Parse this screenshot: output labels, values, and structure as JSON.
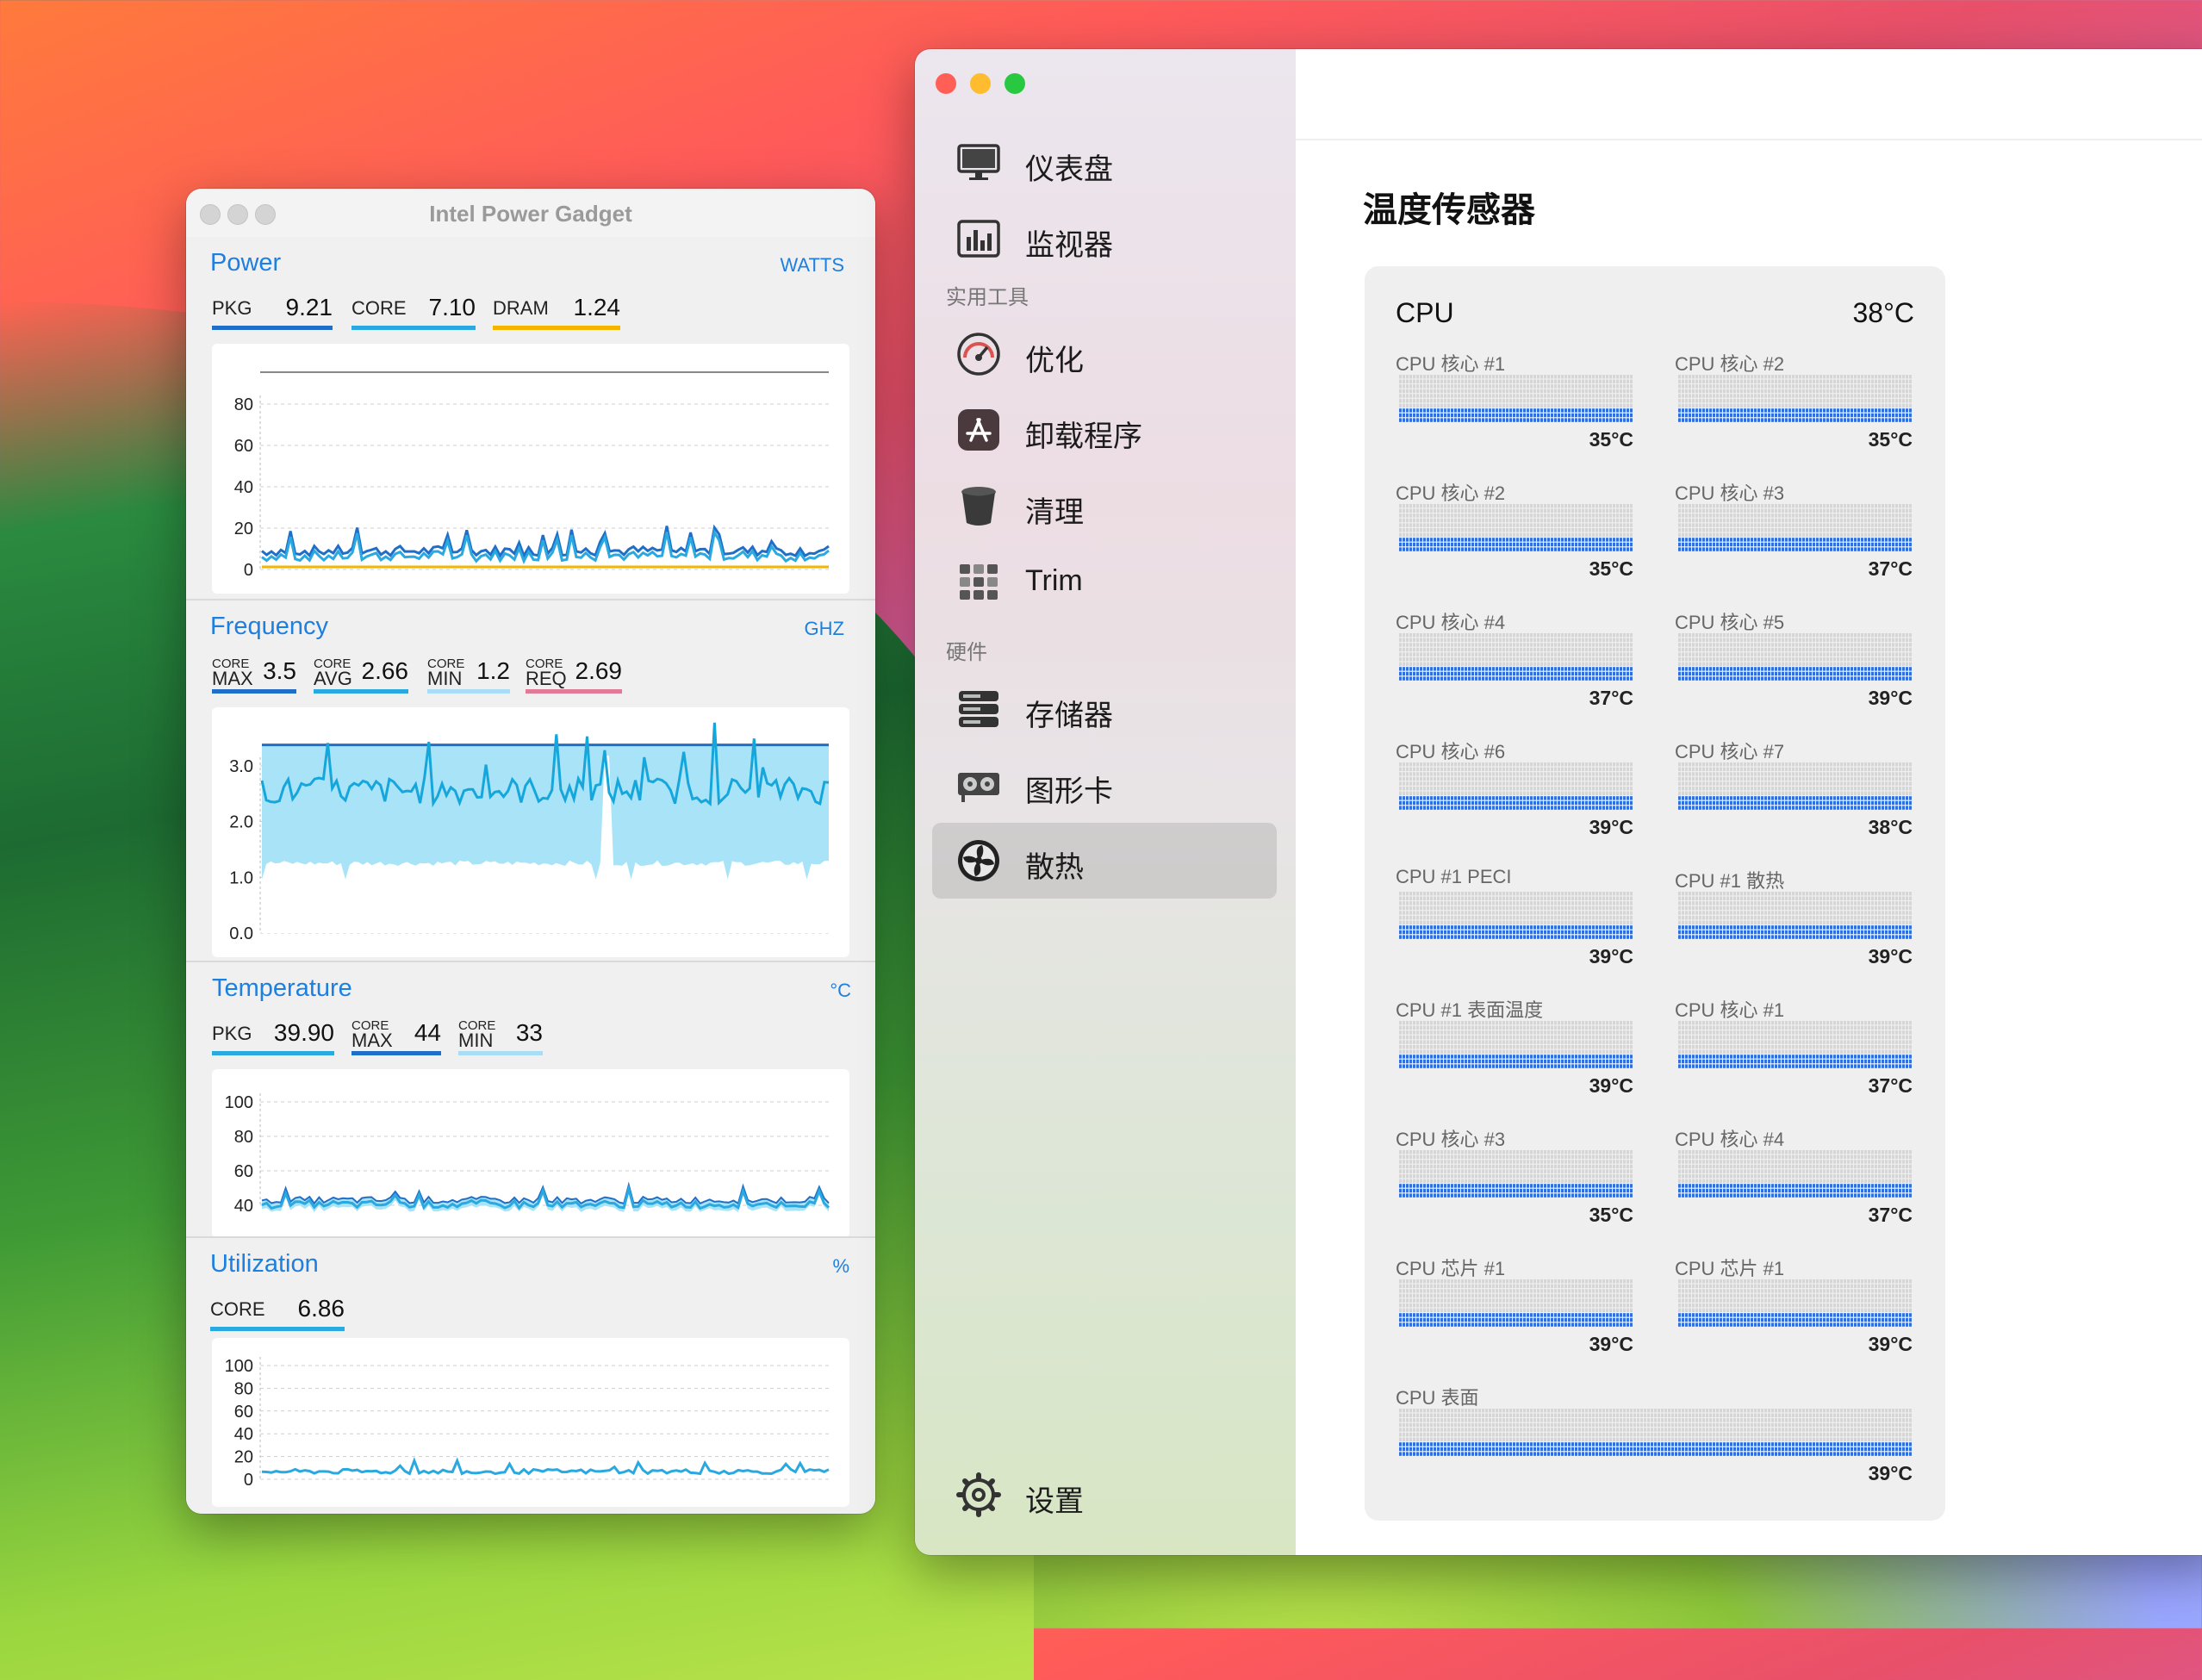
{
  "ipg": {
    "title": "Intel Power Gadget",
    "power": {
      "title": "Power",
      "unit": "WATTS",
      "metrics": [
        {
          "label": "PKG",
          "value": "9.21",
          "color": "#1f6fc8"
        },
        {
          "label": "CORE",
          "value": "7.10",
          "color": "#2aa8e0"
        },
        {
          "label": "DRAM",
          "value": "1.24",
          "color": "#f5b400"
        }
      ],
      "yticks": [
        "80",
        "60",
        "40",
        "20",
        "0"
      ]
    },
    "frequency": {
      "title": "Frequency",
      "unit": "GHZ",
      "metrics": [
        {
          "small": "CORE",
          "label": "MAX",
          "value": "3.5",
          "color": "#1f6fc8"
        },
        {
          "small": "CORE",
          "label": "AVG",
          "value": "2.66",
          "color": "#2aa8e0"
        },
        {
          "small": "CORE",
          "label": "MIN",
          "value": "1.2",
          "color": "#a9dcf5"
        },
        {
          "small": "CORE",
          "label": "REQ",
          "value": "2.69",
          "color": "#e07a96"
        }
      ],
      "yticks": [
        "3.0",
        "2.0",
        "1.0",
        "0.0"
      ]
    },
    "temperature": {
      "title": "Temperature",
      "unit": "°C",
      "metrics": [
        {
          "label": "PKG",
          "value": "39.90",
          "color": "#2aa8e0"
        },
        {
          "small": "CORE",
          "label": "MAX",
          "value": "44",
          "color": "#1f6fc8"
        },
        {
          "small": "CORE",
          "label": "MIN",
          "value": "33",
          "color": "#a9dcf5"
        }
      ],
      "yticks": [
        "100",
        "80",
        "60",
        "40"
      ]
    },
    "utilization": {
      "title": "Utilization",
      "unit": "%",
      "metrics": [
        {
          "label": "CORE",
          "value": "6.86",
          "color": "#2aa8e0"
        }
      ],
      "yticks": [
        "100",
        "80",
        "60",
        "40",
        "20",
        "0"
      ]
    }
  },
  "app": {
    "nav": {
      "dashboard": "仪表盘",
      "monitor": "监视器",
      "section_utilities": "实用工具",
      "optimize": "优化",
      "uninstall": "卸载程序",
      "clean": "清理",
      "trim": "Trim",
      "section_hardware": "硬件",
      "storage": "存储器",
      "graphics": "图形卡",
      "cooling": "散热",
      "settings": "设置"
    },
    "page_title": "温度传感器",
    "card": {
      "title": "CPU",
      "temp": "38°C",
      "sensors": [
        {
          "name": "CPU 核心 #1",
          "temp": "35°C",
          "level": 0.35
        },
        {
          "name": "CPU 核心 #2",
          "temp": "35°C",
          "level": 0.35
        },
        {
          "name": "CPU 核心 #2",
          "temp": "35°C",
          "level": 0.35
        },
        {
          "name": "CPU 核心 #3",
          "temp": "37°C",
          "level": 0.37
        },
        {
          "name": "CPU 核心 #4",
          "temp": "37°C",
          "level": 0.37
        },
        {
          "name": "CPU 核心 #5",
          "temp": "39°C",
          "level": 0.39
        },
        {
          "name": "CPU 核心 #6",
          "temp": "39°C",
          "level": 0.39
        },
        {
          "name": "CPU 核心 #7",
          "temp": "38°C",
          "level": 0.38
        },
        {
          "name": "CPU #1 PECI",
          "temp": "39°C",
          "level": 0.39
        },
        {
          "name": "CPU #1 散热",
          "temp": "39°C",
          "level": 0.39
        },
        {
          "name": "CPU #1 表面温度",
          "temp": "39°C",
          "level": 0.39
        },
        {
          "name": "CPU 核心 #1",
          "temp": "37°C",
          "level": 0.37
        },
        {
          "name": "CPU 核心 #3",
          "temp": "35°C",
          "level": 0.35
        },
        {
          "name": "CPU 核心 #4",
          "temp": "37°C",
          "level": 0.37
        },
        {
          "name": "CPU 芯片 #1",
          "temp": "39°C",
          "level": 0.39
        },
        {
          "name": "CPU 芯片 #1",
          "temp": "39°C",
          "level": 0.39
        },
        {
          "name": "CPU 表面",
          "temp": "39°C",
          "level": 0.39
        }
      ]
    }
  },
  "colors": {
    "accent_blue": "#1d7fe0",
    "bar_blue": "#2f6fe0",
    "close": "#ff5f57",
    "minimize": "#febc2e",
    "zoom": "#28c840"
  }
}
